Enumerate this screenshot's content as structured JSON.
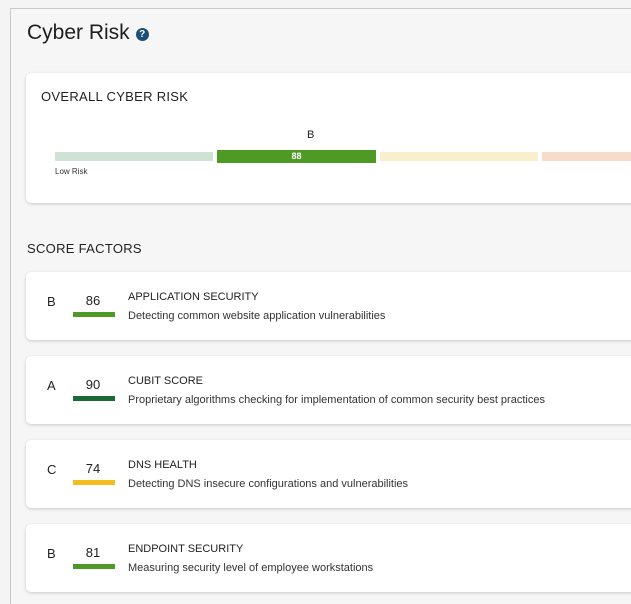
{
  "page": {
    "title": "Cyber Risk",
    "help_icon": "?"
  },
  "overall": {
    "label": "OVERALL CYBER RISK",
    "grade": "B",
    "score": "88",
    "scale_low_label": "Low Risk"
  },
  "score_factors": {
    "title": "SCORE FACTORS",
    "items": [
      {
        "grade": "B",
        "score": "86",
        "name": "APPLICATION SECURITY",
        "description": "Detecting common website application vulnerabilities",
        "bar_color": "#4e9a25"
      },
      {
        "grade": "A",
        "score": "90",
        "name": "CUBIT SCORE",
        "description": "Proprietary algorithms checking for implementation of common security best practices",
        "bar_color": "#1b6a36"
      },
      {
        "grade": "C",
        "score": "74",
        "name": "DNS HEALTH",
        "description": "Detecting DNS insecure configurations and vulnerabilities",
        "bar_color": "#f2bd1d"
      },
      {
        "grade": "B",
        "score": "81",
        "name": "ENDPOINT SECURITY",
        "description": "Measuring security level of employee workstations",
        "bar_color": "#4e9a25"
      }
    ]
  }
}
